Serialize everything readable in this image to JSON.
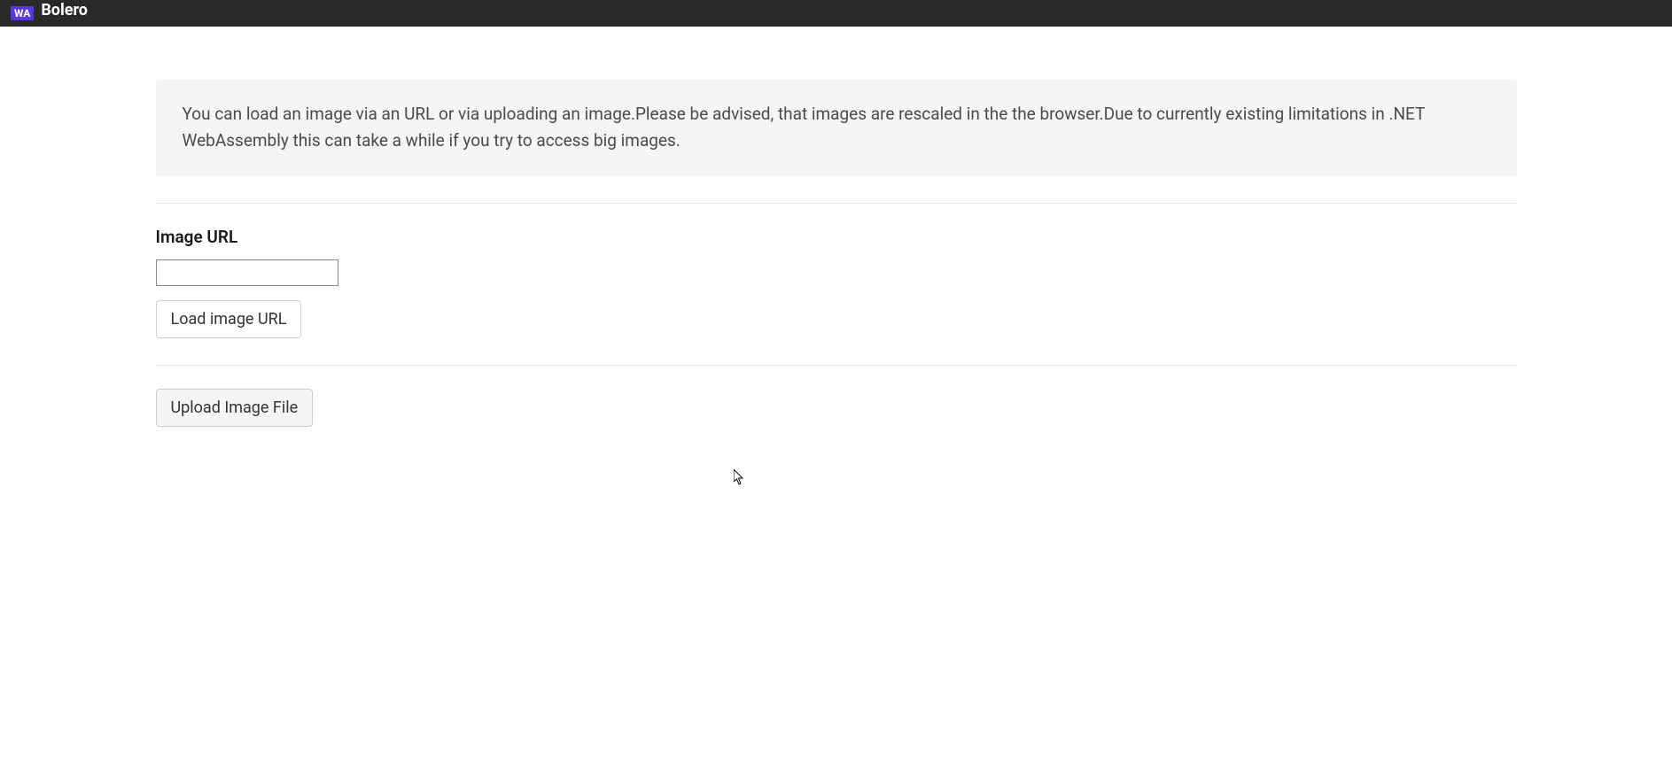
{
  "topbar": {
    "badge": "WA",
    "title": "Bolero"
  },
  "info": {
    "text": "You can load an image via an URL or via uploading an image.Please be advised, that images are rescaled in the the browser.Due to currently existing limitations in .NET WebAssembly this can take a while if you try to access big images."
  },
  "urlSection": {
    "label": "Image URL",
    "inputValue": "",
    "buttonLabel": "Load image URL"
  },
  "uploadSection": {
    "buttonLabel": "Upload Image File"
  }
}
